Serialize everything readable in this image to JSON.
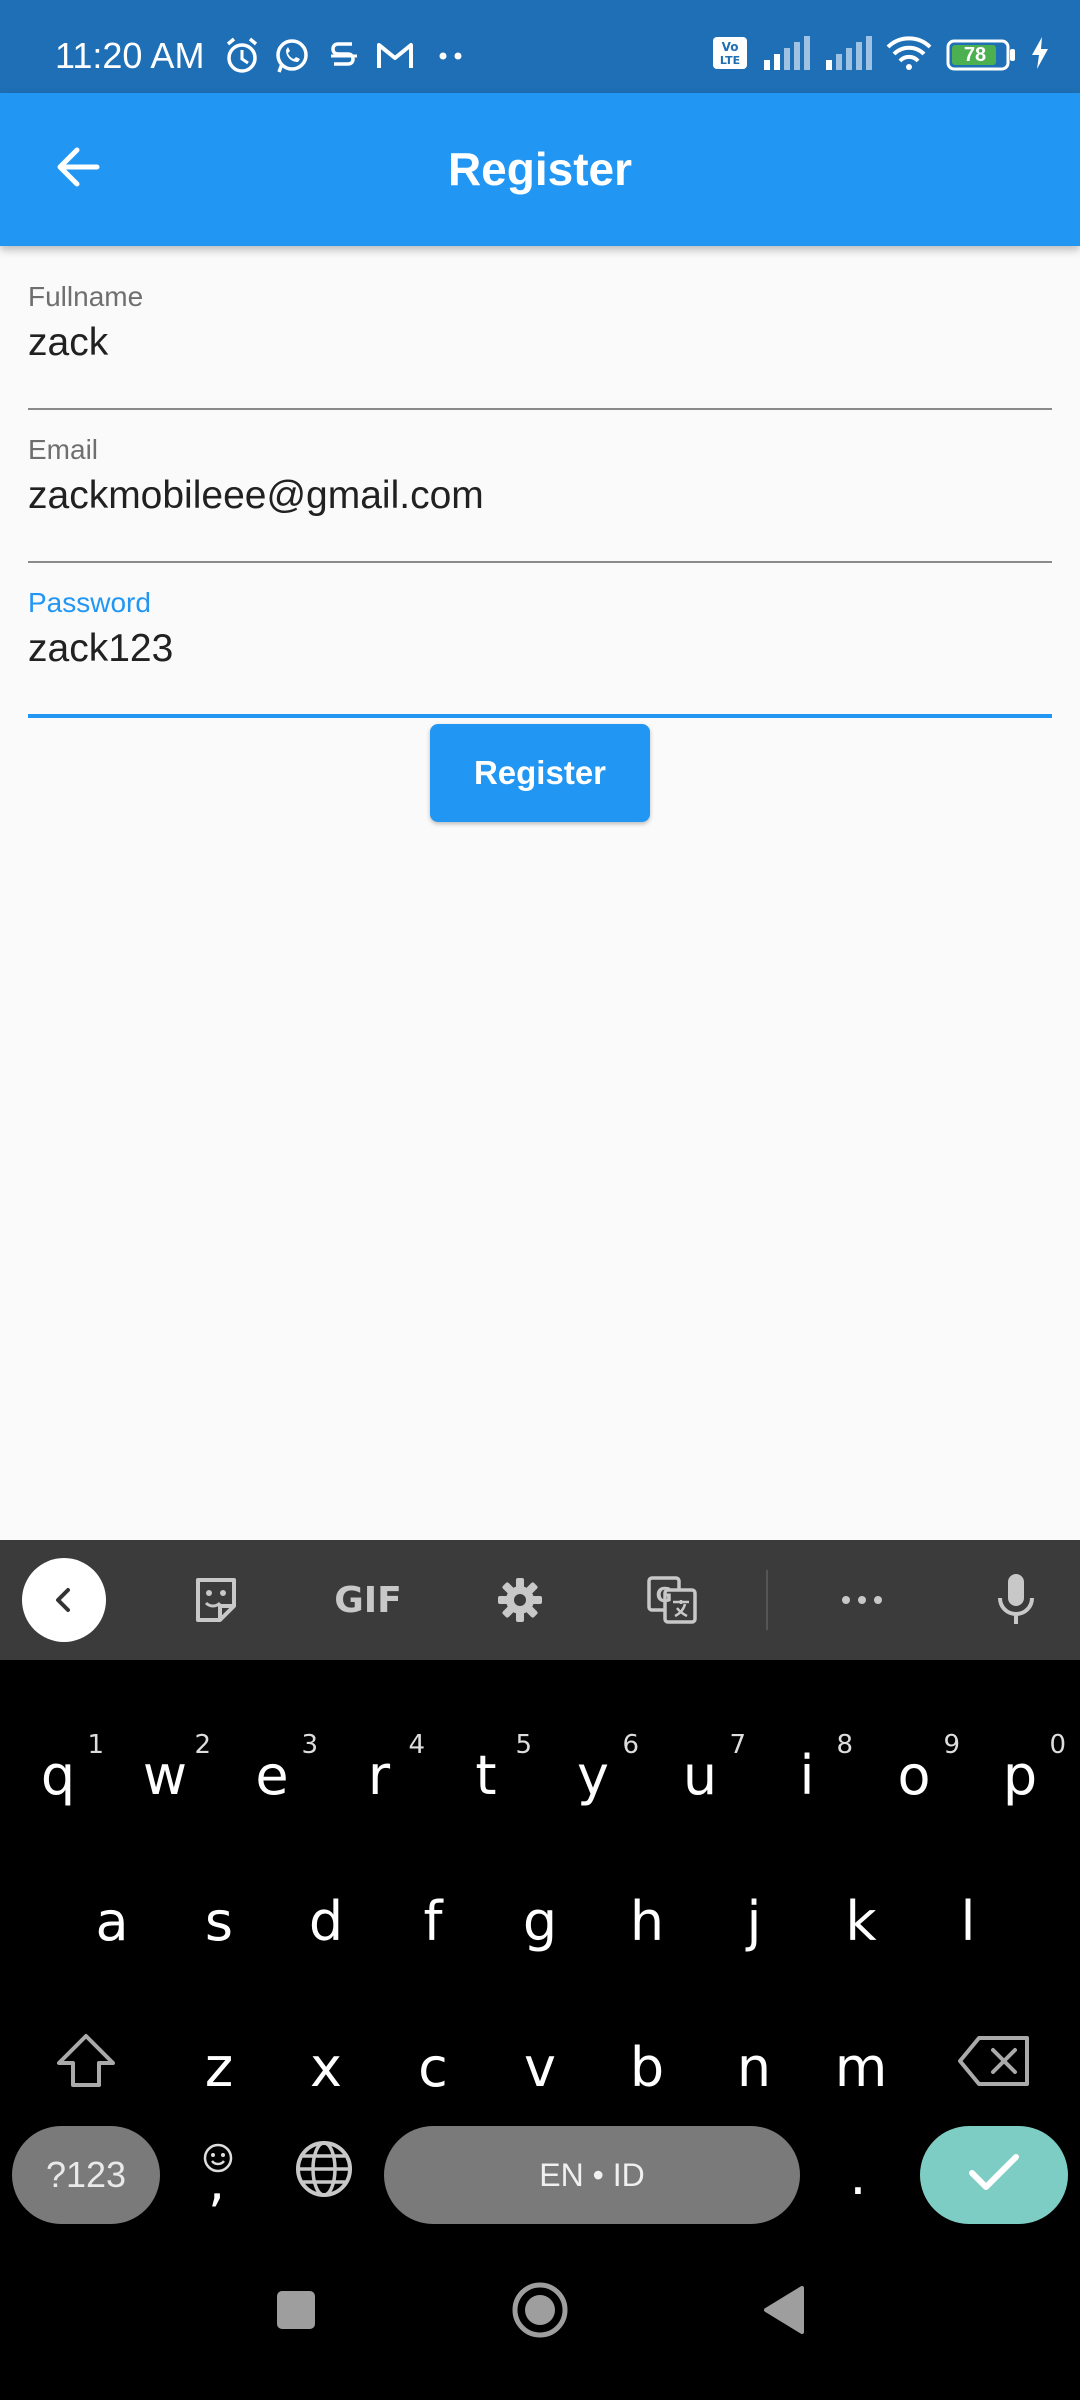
{
  "status_bar": {
    "time": "11:20 AM",
    "battery": "78",
    "left_icons": [
      "alarm-icon",
      "whatsapp-icon",
      "notification-s-icon",
      "gmail-icon",
      "more-dots-icon"
    ],
    "right_icons": [
      "volte-icon",
      "signal-1-icon",
      "signal-2-icon",
      "wifi-icon",
      "battery-icon",
      "charging-icon"
    ]
  },
  "app_bar": {
    "title": "Register",
    "back_icon": "arrow-back-icon",
    "color": "#2196f3"
  },
  "form": {
    "fullname": {
      "label": "Fullname",
      "value": "zack"
    },
    "email": {
      "label": "Email",
      "value": "zackmobileee@gmail.com"
    },
    "password": {
      "label": "Password",
      "value": "zack123",
      "focused": true
    },
    "register_label": "Register"
  },
  "keyboard": {
    "toolbar": [
      "collapse-chevron-icon",
      "sticker-icon",
      "gif-icon",
      "settings-gear-icon",
      "translate-icon",
      "more-icon",
      "microphone-icon"
    ],
    "gif_label": "GIF",
    "rows": [
      [
        "q",
        "w",
        "e",
        "r",
        "t",
        "y",
        "u",
        "i",
        "o",
        "p"
      ],
      [
        "a",
        "s",
        "d",
        "f",
        "g",
        "h",
        "j",
        "k",
        "l"
      ],
      [
        "z",
        "x",
        "c",
        "v",
        "b",
        "n",
        "m"
      ]
    ],
    "number_hints": [
      "1",
      "2",
      "3",
      "4",
      "5",
      "6",
      "7",
      "8",
      "9",
      "0"
    ],
    "symbols_label": "?123",
    "comma_label": ",",
    "space_label": "EN • ID",
    "period_label": ".",
    "enter_color": "#7ecdc4"
  },
  "nav_bar": [
    "recents-square-icon",
    "home-circle-icon",
    "back-triangle-icon"
  ]
}
